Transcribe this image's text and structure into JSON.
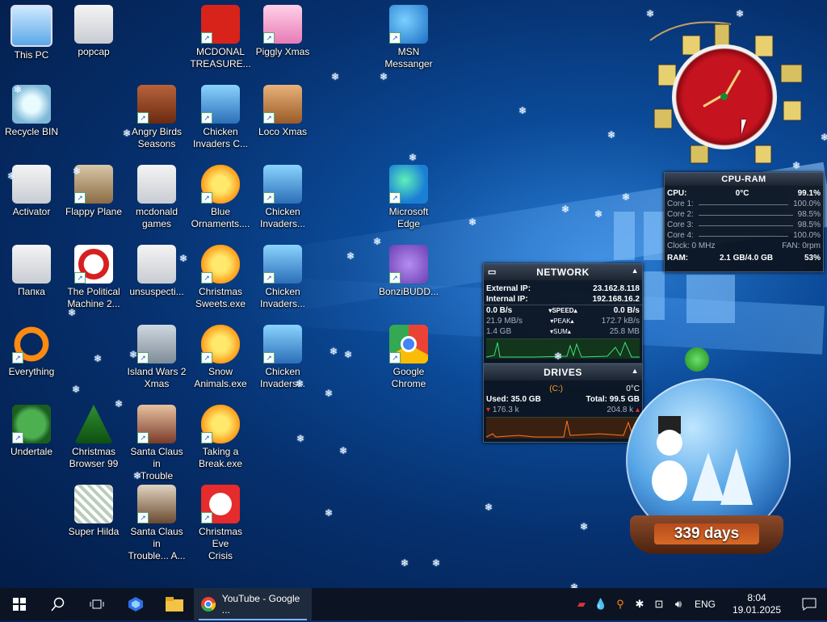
{
  "desktop": {
    "icons": [
      {
        "label": "This PC"
      },
      {
        "label": "popcap"
      },
      {
        "label": "MCDONAL\nTREASURE..."
      },
      {
        "label": "Piggly Xmas"
      },
      {
        "label": "MSN\nMessanger"
      },
      {
        "label": "Recycle BIN"
      },
      {
        "label": "Angry Birds\nSeasons"
      },
      {
        "label": "Chicken\nInvaders C..."
      },
      {
        "label": "Loco Xmas"
      },
      {
        "label": "Activator"
      },
      {
        "label": "Flappy Plane"
      },
      {
        "label": "mcdonald\ngames"
      },
      {
        "label": "Blue\nOrnaments...."
      },
      {
        "label": "Chicken\nInvaders..."
      },
      {
        "label": "Microsoft\nEdge"
      },
      {
        "label": "Папка"
      },
      {
        "label": "The Political\nMachine 2..."
      },
      {
        "label": "unsuspecti..."
      },
      {
        "label": "Christmas\nSweets.exe"
      },
      {
        "label": "Chicken\nInvaders..."
      },
      {
        "label": "BonziBUDD..."
      },
      {
        "label": "Everything"
      },
      {
        "label": "Island Wars 2\nXmas"
      },
      {
        "label": "Snow\nAnimals.exe"
      },
      {
        "label": "Chicken\nInvaders..."
      },
      {
        "label": "Google\nChrome"
      },
      {
        "label": "Undertale"
      },
      {
        "label": "Christmas\nBrowser 99"
      },
      {
        "label": "Santa Claus in\nTrouble"
      },
      {
        "label": "Taking a\nBreak.exe"
      },
      {
        "label": "Super Hilda"
      },
      {
        "label": "Santa Claus in\nTrouble... A..."
      },
      {
        "label": "Christmas Eve\nCrisis"
      }
    ]
  },
  "cpu_ram": {
    "title": "CPU-RAM",
    "cpu_label": "CPU:",
    "cpu_temp": "0°C",
    "cpu_value": "99.1%",
    "cores": [
      {
        "label": "Core 1:",
        "value": "100.0%"
      },
      {
        "label": "Core 2:",
        "value": "98.5%"
      },
      {
        "label": "Core 3:",
        "value": "98.5%"
      },
      {
        "label": "Core 4:",
        "value": "100.0%"
      }
    ],
    "clock_label": "Clock: 0 MHz",
    "fan_label": "FAN: 0rpm",
    "ram_label": "RAM:",
    "ram_value": "2.1 GB/4.0 GB",
    "ram_pct": "53%"
  },
  "network": {
    "title": "NETWORK",
    "external_label": "External IP:",
    "external_value": "23.162.8.118",
    "internal_label": "Internal IP:",
    "internal_value": "192.168.16.2",
    "speed_left": "0.0 B/s",
    "speed_label": "SPEED",
    "speed_right": "0.0 B/s",
    "peak_left": "21.9 MB/s",
    "peak_label": "PEAK",
    "peak_right": "172.7 kB/s",
    "sum_left": "1.4 GB",
    "sum_label": "SUM",
    "sum_right": "25.8 MB"
  },
  "drives": {
    "title": "DRIVES",
    "drive": "(C:)",
    "temp": "0°C",
    "used": "Used: 35.0 GB",
    "total": "Total: 99.5 GB",
    "read": "176.3 k",
    "write": "204.8 k"
  },
  "snowglobe": {
    "countdown": "339 days"
  },
  "taskbar": {
    "running_app": "YouTube - Google ...",
    "language": "ENG",
    "time": "8:04",
    "date": "19.01.2025"
  }
}
